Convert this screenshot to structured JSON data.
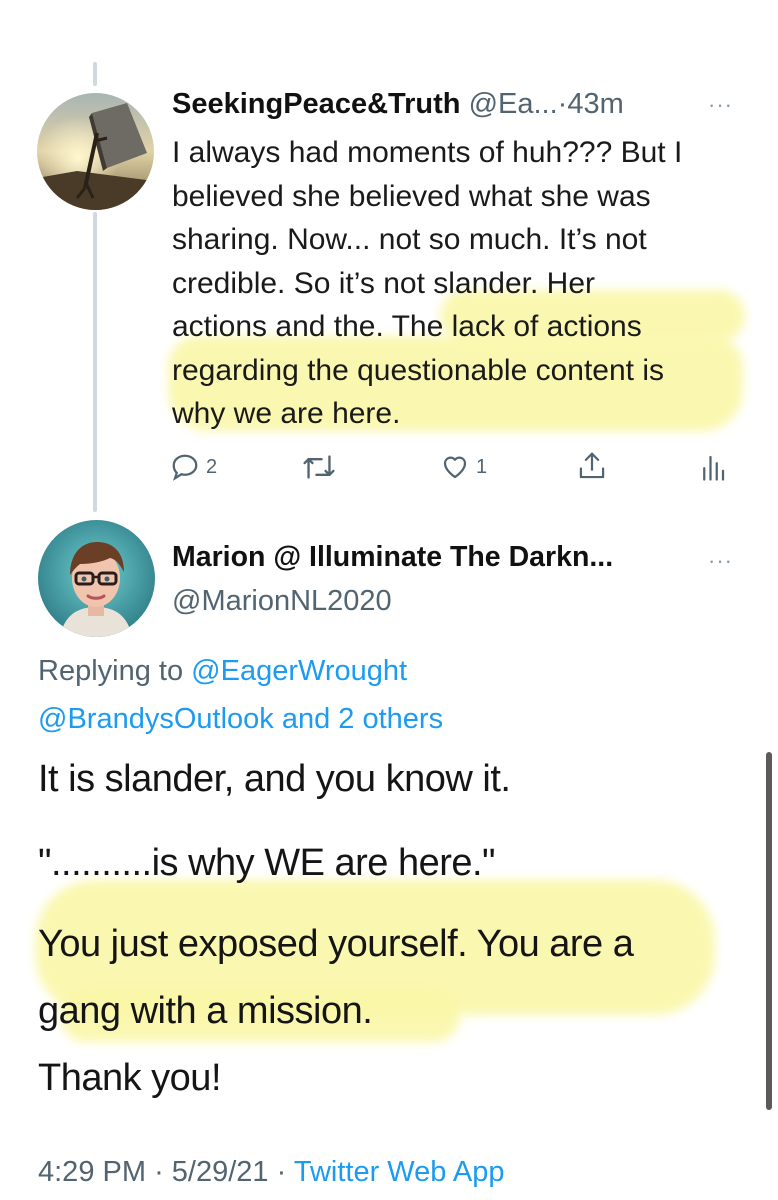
{
  "tweet1": {
    "name": "SeekingPeace&Truth",
    "handle": "@Ea...",
    "separator": "·",
    "time": "43m",
    "more": "···",
    "lines": [
      "I always had moments of huh??? But I",
      "believed she believed what she was",
      "sharing. Now... not so much. It’s not",
      "credible. So it’s not slander. Her",
      "actions and the. The lack of actions",
      "regarding the questionable content is",
      "why we are here."
    ],
    "actions": {
      "replies": "2",
      "retweets": "",
      "likes": "1"
    }
  },
  "tweet2": {
    "name": "Marion @ Illuminate The Darkn...",
    "handle": "@MarionNL2020",
    "more": "···",
    "replying_prefix": "Replying to",
    "replying_user": "@EagerWrought",
    "replying_user2": "@BrandysOutlook",
    "replying_others": "and 2 others",
    "lines": [
      "It is slander, and you know it.",
      "\"..........is why WE are here.\"",
      "You just exposed yourself. You are a",
      "gang with a mission.",
      "Thank you!"
    ],
    "time": "4:29 PM",
    "date": "5/29/21",
    "separator": "·",
    "source": "Twitter Web App"
  },
  "colors": {
    "link": "#1d9bf0",
    "secondary": "#536471",
    "highlight": "#faf7a8",
    "thread_line": "#cfd9de"
  },
  "icons": [
    "reply-icon",
    "retweet-icon",
    "like-icon",
    "share-icon",
    "analytics-icon",
    "more-icon"
  ]
}
